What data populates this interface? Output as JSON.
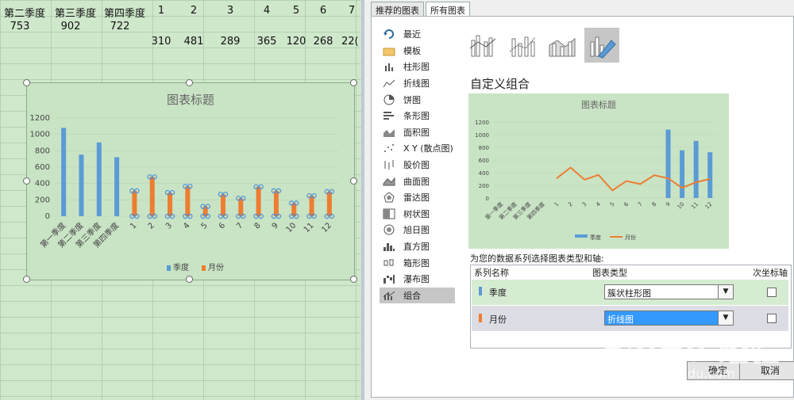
{
  "sheet": {
    "headers": [
      "第二季度",
      "第三季度",
      "第四季度",
      "1",
      "2",
      "3",
      "4",
      "5",
      "6",
      "7"
    ],
    "row2": [
      "753",
      "902",
      "722"
    ],
    "row3": [
      "310",
      "481",
      "289",
      "365",
      "120",
      "268",
      "22("
    ]
  },
  "chart_data": [
    {
      "type": "bar",
      "title": "图表标题",
      "categories": [
        "第一季度",
        "第二季度",
        "第三季度",
        "第四季度",
        "1",
        "2",
        "3",
        "4",
        "5",
        "6",
        "7",
        "8",
        "9",
        "10",
        "11",
        "12"
      ],
      "ylim": [
        0,
        1200
      ],
      "yticks": [
        0,
        200,
        400,
        600,
        800,
        1000,
        1200
      ],
      "series": [
        {
          "name": "季度",
          "color": "#5b9bd5",
          "values": [
            1080,
            753,
            902,
            722,
            null,
            null,
            null,
            null,
            null,
            null,
            null,
            null,
            null,
            null,
            null,
            null
          ]
        },
        {
          "name": "月份",
          "color": "#ed7d31",
          "values": [
            null,
            null,
            null,
            null,
            310,
            481,
            289,
            365,
            120,
            268,
            220,
            360,
            310,
            160,
            250,
            300
          ]
        }
      ],
      "legend": "bottom"
    },
    {
      "type": "bar",
      "title": "图表标题",
      "categories": [
        "第一季度",
        "第二季度",
        "第三季度",
        "第四季度",
        "1",
        "2",
        "3",
        "4",
        "5",
        "6",
        "7",
        "8",
        "9",
        "10",
        "11",
        "12"
      ],
      "ylim": [
        0,
        1200
      ],
      "yticks": [
        0,
        200,
        400,
        600,
        800,
        1000,
        1200
      ],
      "series": [
        {
          "name": "季度",
          "kind": "bar",
          "color": "#5b9bd5",
          "values": [
            1080,
            753,
            902,
            722
          ]
        },
        {
          "name": "月份",
          "kind": "line",
          "color": "#ed7d31",
          "values": [
            310,
            481,
            289,
            365,
            120,
            268,
            220,
            360,
            310,
            160,
            250,
            300
          ]
        }
      ],
      "legend": "bottom"
    }
  ],
  "dialog": {
    "tabs": [
      "推荐的图表",
      "所有图表"
    ],
    "chart_types": [
      {
        "label": "最近",
        "icon": "recent-icon"
      },
      {
        "label": "模板",
        "icon": "folder-icon"
      },
      {
        "label": "柱形图",
        "icon": "column-chart-icon"
      },
      {
        "label": "折线图",
        "icon": "line-chart-icon"
      },
      {
        "label": "饼图",
        "icon": "pie-chart-icon"
      },
      {
        "label": "条形图",
        "icon": "bar-chart-icon"
      },
      {
        "label": "面积图",
        "icon": "area-chart-icon"
      },
      {
        "label": "X Y (散点图)",
        "icon": "scatter-chart-icon"
      },
      {
        "label": "股价图",
        "icon": "stock-chart-icon"
      },
      {
        "label": "曲面图",
        "icon": "surface-chart-icon"
      },
      {
        "label": "雷达图",
        "icon": "radar-chart-icon"
      },
      {
        "label": "树状图",
        "icon": "treemap-icon"
      },
      {
        "label": "旭日图",
        "icon": "sunburst-icon"
      },
      {
        "label": "直方图",
        "icon": "histogram-icon"
      },
      {
        "label": "箱形图",
        "icon": "box-whisker-icon"
      },
      {
        "label": "瀑布图",
        "icon": "waterfall-icon"
      },
      {
        "label": "组合",
        "icon": "combo-chart-icon"
      }
    ],
    "section_title": "自定义组合",
    "series_prompt": "为您的数据系列选择图表类型和轴:",
    "table_headers": [
      "系列名称",
      "图表类型",
      "次坐标轴"
    ],
    "series_rows": [
      {
        "name": "季度",
        "color": "#5b9bd5",
        "type": "簇状柱形图"
      },
      {
        "name": "月份",
        "color": "#ed7d31",
        "type": "折线图"
      }
    ],
    "ok": "确定",
    "cancel": "取消"
  },
  "watermark": {
    "brand": "Baidu经验",
    "url": "jingyan.baidu.com"
  }
}
